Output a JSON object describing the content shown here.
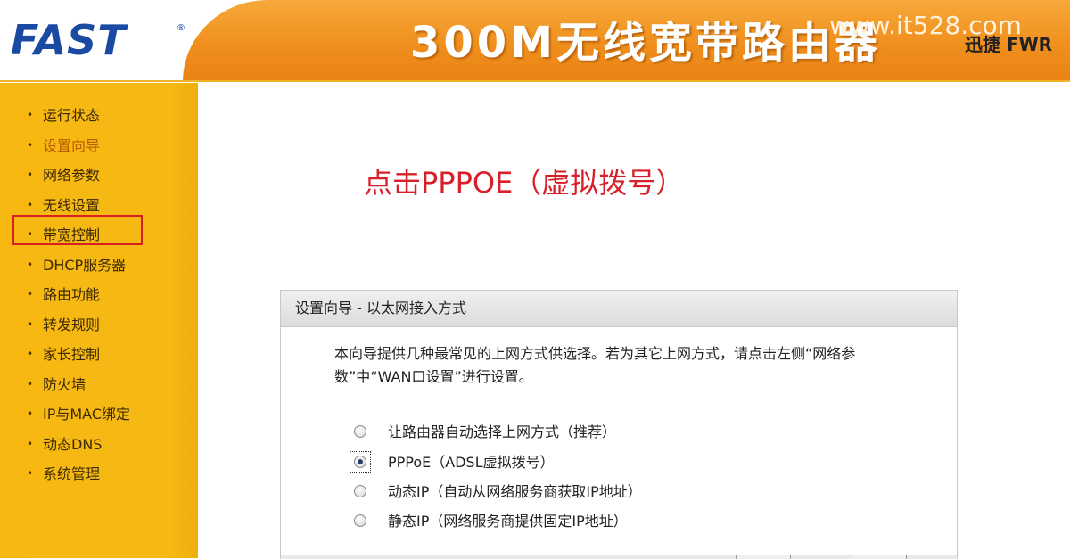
{
  "header": {
    "logo": "FAST",
    "logo_reg": "®",
    "title": "300M无线宽带路由器",
    "watermark": "www.it528.com",
    "brand": "迅捷 FWR"
  },
  "sidebar": {
    "items": [
      {
        "label": "运行状态"
      },
      {
        "label": "设置向导"
      },
      {
        "label": "网络参数"
      },
      {
        "label": "无线设置"
      },
      {
        "label": "带宽控制"
      },
      {
        "label": "DHCP服务器"
      },
      {
        "label": "路由功能"
      },
      {
        "label": "转发规则"
      },
      {
        "label": "家长控制"
      },
      {
        "label": "防火墙"
      },
      {
        "label": "IP与MAC绑定"
      },
      {
        "label": "动态DNS"
      },
      {
        "label": "系统管理"
      }
    ],
    "bullet": "•"
  },
  "annotation": "点击PPPOE（虚拟拨号）",
  "panel": {
    "title": "设置向导 - 以太网接入方式",
    "description": "本向导提供几种最常见的上网方式供选择。若为其它上网方式，请点击左侧“网络参数”中“WAN口设置”进行设置。",
    "options": [
      {
        "label": "让路由器自动选择上网方式（推荐）",
        "checked": false
      },
      {
        "label": "PPPoE（ADSL虚拟拨号）",
        "checked": true
      },
      {
        "label": "动态IP（自动从网络服务商获取IP地址）",
        "checked": false
      },
      {
        "label": "静态IP（网络服务商提供固定IP地址）",
        "checked": false
      }
    ]
  },
  "colors": {
    "sidebar_bg": "#f7b711",
    "header_band": "#f08f1d",
    "annotation": "#d8202a",
    "highlight": "#d92020",
    "logo": "#1b4aa3"
  }
}
